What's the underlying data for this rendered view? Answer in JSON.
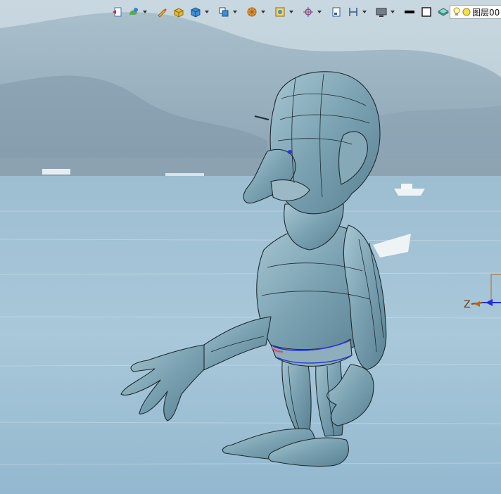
{
  "toolbar": {
    "buttons": [
      {
        "name": "view-back-button",
        "icon": "back-arrow-icon",
        "dropdown": false
      },
      {
        "name": "display-style-button",
        "icon": "palette-icon",
        "dropdown": true
      },
      {
        "name": "pencil-tool-button",
        "icon": "pencil-icon",
        "dropdown": false
      },
      {
        "name": "shaded-box-button",
        "icon": "box-icon",
        "dropdown": false
      },
      {
        "name": "cube-view-button",
        "icon": "cube-icon",
        "dropdown": true
      },
      {
        "name": "section-view-button",
        "icon": "section-icon",
        "dropdown": true
      },
      {
        "name": "lighting-button",
        "icon": "sun-wheel-icon",
        "dropdown": true
      },
      {
        "name": "fit-view-button",
        "icon": "fit-icon",
        "dropdown": true
      },
      {
        "name": "orient-button",
        "icon": "crosshair-icon",
        "dropdown": true
      },
      {
        "name": "frame-button",
        "icon": "frame-icon",
        "dropdown": false
      },
      {
        "name": "measure-button",
        "icon": "measure-icon",
        "dropdown": true
      },
      {
        "name": "monitor-button",
        "icon": "monitor-icon",
        "dropdown": true
      },
      {
        "name": "line-color-button",
        "icon": "line-swatch-icon",
        "dropdown": false
      },
      {
        "name": "fill-color-button",
        "icon": "square-outline-icon",
        "dropdown": false
      },
      {
        "name": "layer-stack-button",
        "icon": "layers-icon",
        "dropdown": true
      }
    ]
  },
  "layer": {
    "value": "图层00"
  },
  "triad": {
    "axis_label": "Z"
  }
}
